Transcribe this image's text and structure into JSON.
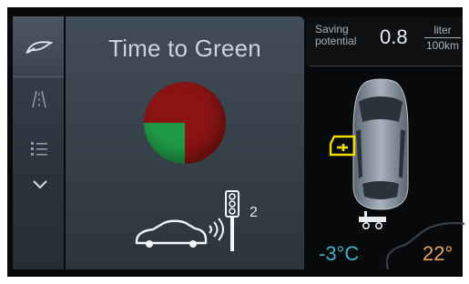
{
  "app": {
    "title": "Time to Green"
  },
  "sidebar": {
    "items": [
      {
        "name": "eco-leaf",
        "icon": "leaf-icon"
      },
      {
        "name": "road",
        "icon": "road-lanes-icon"
      },
      {
        "name": "list",
        "icon": "list-icon"
      },
      {
        "name": "more",
        "icon": "chevron-down-icon"
      }
    ]
  },
  "signal": {
    "count": "2",
    "progress_red_fraction": 0.75,
    "colors": {
      "red": "#8b1413",
      "green": "#1f9a45"
    }
  },
  "saving": {
    "label_line1": "Saving",
    "label_line2": "potential",
    "value": "0.8",
    "unit_top": "liter",
    "unit_bottom": "100km"
  },
  "climate": {
    "outside_temp": "-3°C",
    "inside_temp": "22°",
    "outside_color": "#3fb3c6",
    "inside_color": "#e2a366"
  },
  "vehicle": {
    "warning_icon": "door-open-warning-icon",
    "trailer_icon": "trailer-icon",
    "warning_color": "#f2dd00"
  }
}
